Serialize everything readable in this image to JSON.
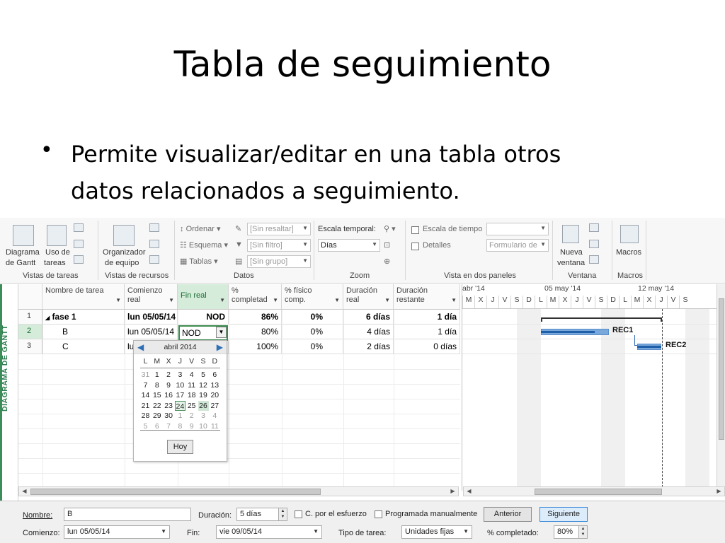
{
  "slide": {
    "title": "Tabla de seguimiento",
    "bullet_line1": "Permite visualizar/editar en una tabla otros",
    "bullet_line2": "datos relacionados a seguimiento."
  },
  "ribbon": {
    "diagrama_gantt_line1": "Diagrama",
    "diagrama_gantt_line2": "de Gantt",
    "uso_tareas_line1": "Uso de",
    "uso_tareas_line2": "tareas",
    "organizador_line1": "Organizador",
    "organizador_line2": "de equipo",
    "ordenar": "Ordenar",
    "esquema": "Esquema",
    "tablas": "Tablas",
    "sin_resaltar": "[Sin resaltar]",
    "sin_filtro": "[Sin filtro]",
    "sin_grupo": "[Sin grupo]",
    "escala_temporal_label": "Escala temporal:",
    "escala_temporal_value": "Días",
    "escala_de_tiempo": "Escala de tiempo",
    "detalles": "Detalles",
    "formulario_de": "Formulario de",
    "nueva_ventana_line1": "Nueva",
    "nueva_ventana_line2": "ventana",
    "macros": "Macros",
    "groups": {
      "vistas_tareas": "Vistas de tareas",
      "vistas_recursos": "Vistas de recursos",
      "datos": "Datos",
      "zoom": "Zoom",
      "vista_dos_paneles": "Vista en dos paneles",
      "ventana": "Ventana",
      "macros": "Macros"
    }
  },
  "view_label": "DIAGRAMA DE GANTT",
  "table": {
    "headers": {
      "nombre": "Nombre de tarea",
      "comienzo_1": "Comienzo",
      "comienzo_2": "real",
      "fin": "Fin real",
      "pct_1": "%",
      "pct_2": "completad",
      "fisico_1": "% físico",
      "fisico_2": "comp.",
      "dur_1": "Duración",
      "dur_2": "real",
      "rest_1": "Duración",
      "rest_2": "restante"
    },
    "rows": [
      {
        "id": "1",
        "nombre": "fase 1",
        "comienzo": "lun 05/05/14",
        "fin": "NOD",
        "pct": "86%",
        "fisico": "0%",
        "dur": "6 días",
        "rest": "1 día"
      },
      {
        "id": "2",
        "nombre": "B",
        "comienzo": "lun 05/05/14",
        "fin": "NOD",
        "pct": "80%",
        "fisico": "0%",
        "dur": "4 días",
        "rest": "1 día"
      },
      {
        "id": "3",
        "nombre": "C",
        "comienzo": "lu",
        "fin": "",
        "pct": "100%",
        "fisico": "0%",
        "dur": "2 días",
        "rest": "0 días"
      }
    ],
    "collapse_glyph": "◢"
  },
  "calendar": {
    "month": "abril 2014",
    "dow": [
      "L",
      "M",
      "X",
      "J",
      "V",
      "S",
      "D"
    ],
    "weeks": [
      [
        "31",
        "1",
        "2",
        "3",
        "4",
        "5",
        "6"
      ],
      [
        "7",
        "8",
        "9",
        "10",
        "11",
        "12",
        "13"
      ],
      [
        "14",
        "15",
        "16",
        "17",
        "18",
        "19",
        "20"
      ],
      [
        "21",
        "22",
        "23",
        "24",
        "25",
        "26",
        "27"
      ],
      [
        "28",
        "29",
        "30",
        "1",
        "2",
        "3",
        "4"
      ],
      [
        "5",
        "6",
        "7",
        "8",
        "9",
        "10",
        "11"
      ]
    ],
    "today_button": "Hoy"
  },
  "timeline": {
    "weeks": [
      "abr '14",
      "05 may '14",
      "12 may '14"
    ],
    "days": [
      "M",
      "X",
      "J",
      "V",
      "S",
      "D",
      "L",
      "M",
      "X",
      "J",
      "V",
      "S",
      "D",
      "L",
      "M",
      "X",
      "J",
      "V",
      "S"
    ],
    "bars": {
      "rec1_label": "REC1",
      "rec2_label": "REC2"
    }
  },
  "form": {
    "nombre_label": "Nombre:",
    "nombre_value": "B",
    "duracion_label": "Duración:",
    "duracion_value": "5 días",
    "c_por_esfuerzo": "C. por el esfuerzo",
    "programada_manualmente": "Programada manualmente",
    "anterior": "Anterior",
    "siguiente": "Siguiente",
    "comienzo_label": "Comienzo:",
    "comienzo_value": "lun 05/05/14",
    "fin_label": "Fin:",
    "fin_value": "vie 09/05/14",
    "tipo_label": "Tipo de tarea:",
    "tipo_value": "Unidades fijas",
    "pct_label": "% completado:",
    "pct_value": "80%"
  },
  "colors": {
    "accent_green": "#3c8d5a",
    "bar_blue": "#79a8dc",
    "progress_blue": "#1f5fa8"
  }
}
